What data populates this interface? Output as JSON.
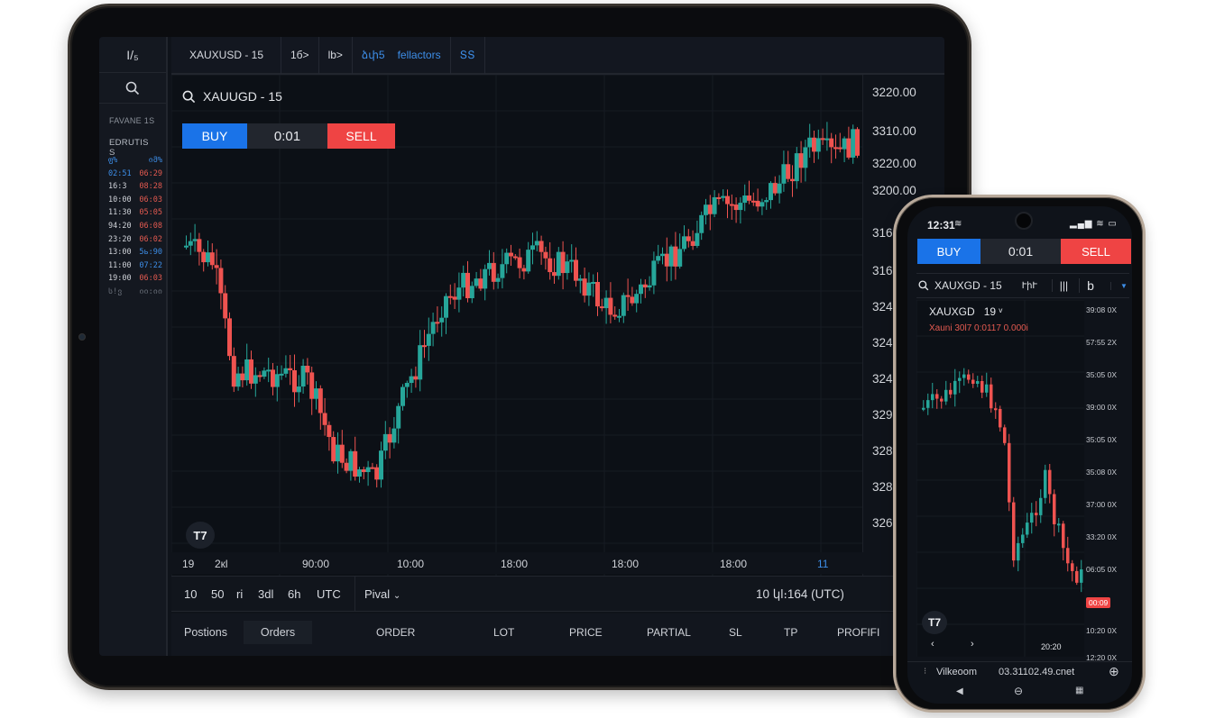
{
  "tablet": {
    "rail": {
      "top_label": "I/₅",
      "favorites_label": "FAVANE 1S",
      "section_label": "EDRUTIS S",
      "watchlist": [
        {
          "time": "ფ%",
          "value": "იმ%",
          "time_color": "#3d8ee8",
          "value_color": "#3d8ee8"
        },
        {
          "time": "02:51",
          "value": "06:29",
          "time_color": "#3d8ee8",
          "value_color": "#e45a50"
        },
        {
          "time": "16:3",
          "value": "08:28",
          "time_color": "#d0d3d9",
          "value_color": "#e45a50"
        },
        {
          "time": "10:00",
          "value": "06:03",
          "time_color": "#d0d3d9",
          "value_color": "#e45a50"
        },
        {
          "time": "11:30",
          "value": "05:05",
          "time_color": "#d0d3d9",
          "value_color": "#e45a50"
        },
        {
          "time": "94:20",
          "value": "06:08",
          "time_color": "#d0d3d9",
          "value_color": "#e45a50"
        },
        {
          "time": "23:20",
          "value": "06:02",
          "time_color": "#d0d3d9",
          "value_color": "#e45a50"
        },
        {
          "time": "13:00",
          "value": "5ь:90",
          "time_color": "#d0d3d9",
          "value_color": "#3d8ee8"
        },
        {
          "time": "11:00",
          "value": "07:22",
          "time_color": "#d0d3d9",
          "value_color": "#3d8ee8"
        },
        {
          "time": "19:00",
          "value": "06:03",
          "time_color": "#d0d3d9",
          "value_color": "#e45a50"
        },
        {
          "time": "ს!ვ",
          "value": "იი:იი",
          "time_color": "#6a707a",
          "value_color": "#6a707a"
        }
      ]
    },
    "tabs": {
      "symbol_tab": "XAUXUSD - 15",
      "t2": "1б>",
      "t3": "lb>",
      "t4": "ձփ5",
      "t5": "fellactors",
      "t6": "ՏՏ"
    },
    "symbol_bar": {
      "title": "XAUUGD - 15"
    },
    "trade": {
      "buy": "BUY",
      "spread": "0:01",
      "sell": "SELL"
    },
    "y_axis": [
      "3220.00",
      "3310.00",
      "3220.00",
      "3200.00",
      "316",
      "316",
      "324",
      "324",
      "324",
      "329",
      "328",
      "328",
      "326"
    ],
    "x_axis": [
      "19",
      "2кl",
      "90:00",
      "10:00",
      "18:00",
      "18:00",
      "18:00",
      "11"
    ],
    "badge": "T7",
    "timeframes": [
      "10",
      "50",
      "ri",
      "3dl",
      "6h",
      "UTC"
    ],
    "indicator": "Pival",
    "clock": "10 կl։164 (UTC)",
    "positions_tabs": [
      "Postions",
      "Orders",
      "ORDER",
      "LOT",
      "PRICE",
      "PARTIAL",
      "SL",
      "TP",
      "PROFIFI"
    ]
  },
  "phone": {
    "time": "12:31",
    "trade": {
      "buy": "BUY",
      "spread": "0:01",
      "sell": "SELL"
    },
    "symbol": "XAUXGD - 15",
    "toolbar": [
      "ՒիՒ",
      "|||",
      "b"
    ],
    "overlay_title": "XAUXGD",
    "overlay_value": "19 ᵛ",
    "overlay_sub": "Xauni 30l7 0:0117 0.000i",
    "y_axis": [
      "39:08 0X",
      "57:55 2X",
      "35:05 0X",
      "39:00 0X",
      "35:05 0X",
      "35:08 0X",
      "37:00 0X",
      "33:20 0X",
      "06:05 0X",
      "00:09",
      "10:20 0X",
      "12:20 0X"
    ],
    "badge": "T7",
    "x_label": "20:20",
    "bottom_left": "Vilkeoom",
    "bottom_right": "03.31102.49.cnet"
  },
  "colors": {
    "buy": "#1a73e8",
    "sell": "#ef4444",
    "up": "#26a69a",
    "down": "#ef5350",
    "bg": "#0f131a"
  }
}
